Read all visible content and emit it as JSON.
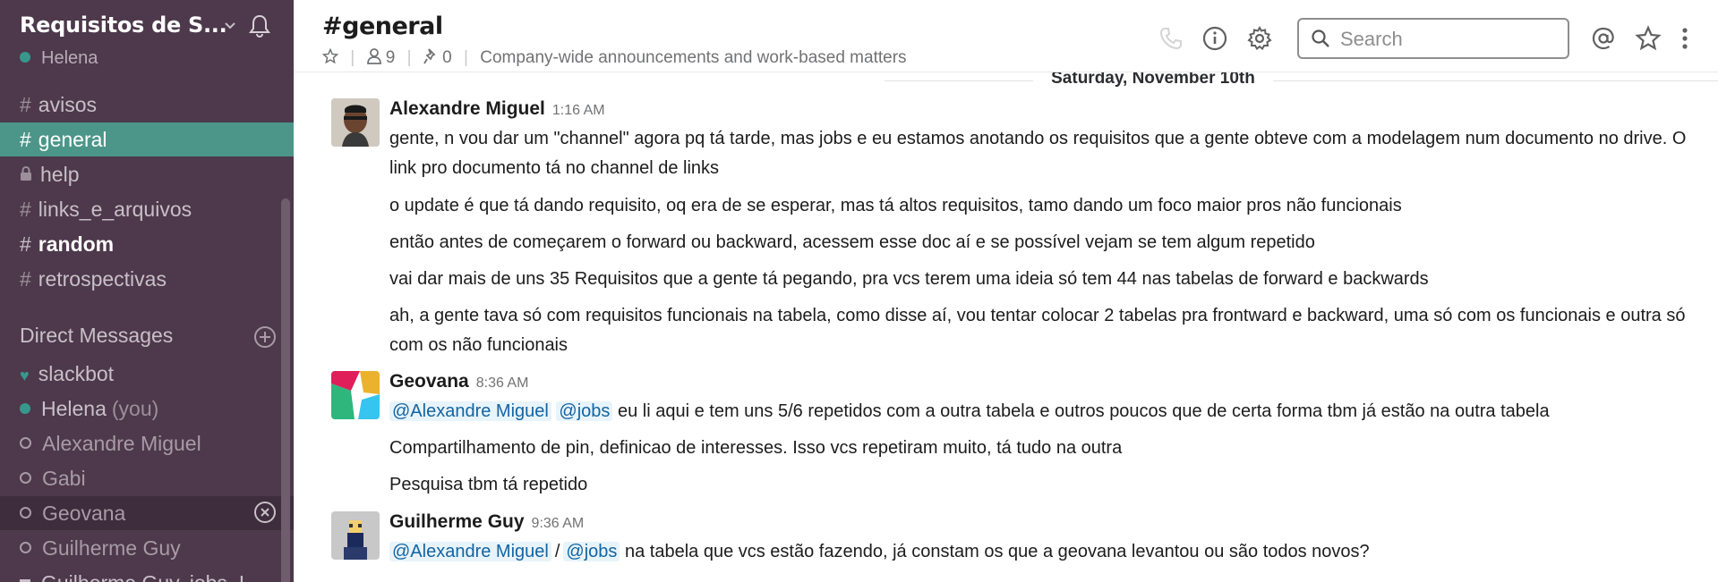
{
  "sidebar": {
    "team_name": "Requisitos de S...",
    "user": "Helena",
    "channels": [
      {
        "name": "avisos"
      },
      {
        "name": "general"
      },
      {
        "name": "help"
      },
      {
        "name": "links_e_arquivos"
      },
      {
        "name": "random"
      },
      {
        "name": "retrospectivas"
      }
    ],
    "dm_header": "Direct Messages",
    "dms": [
      {
        "name": "slackbot"
      },
      {
        "name": "Helena",
        "suffix": "(you)"
      },
      {
        "name": "Alexandre Miguel"
      },
      {
        "name": "Gabi"
      },
      {
        "name": "Geovana"
      },
      {
        "name": "Guilherme Guy"
      },
      {
        "name": "Guilherme Guy, jobs, I"
      }
    ]
  },
  "header": {
    "channel_title": "#general",
    "member_count": "9",
    "pinned_count": "0",
    "topic": "Company-wide announcements and work-based matters",
    "search_placeholder": "Search"
  },
  "messages": {
    "date_divider": "Saturday, November 10th",
    "groups": [
      {
        "author": "Alexandre Miguel",
        "time": "1:16 AM",
        "lines": [
          "gente, n vou dar um \"channel\" agora pq tá tarde, mas jobs e eu estamos anotando os requisitos que a gente obteve com a modelagem num documento no drive. O link pro documento tá no channel de links",
          "o update é que tá dando requisito, oq era de se esperar, mas tá altos requisitos, tamo dando um foco maior pros não funcionais",
          "então antes de começarem o forward ou backward, acessem esse doc aí e se possível vejam se tem algum repetido",
          "vai dar mais de uns 35 Requisitos que a gente tá pegando, pra vcs terem uma ideia só tem 44 nas tabelas de forward e backwards",
          "ah, a gente tava só com requisitos funcionais na tabela, como disse aí, vou tentar colocar 2 tabelas pra frontward e backward, uma só com os funcionais e outra só com os não funcionais"
        ]
      },
      {
        "author": "Geovana",
        "time": "8:36 AM",
        "mention1": "@Alexandre Miguel",
        "mention2": "@jobs",
        "line1_rest": "eu li aqui e tem uns 5/6 repetidos com a outra tabela e outros poucos que de certa forma tbm já estão na outra tabela",
        "lines": [
          "Compartilhamento de pin, definicao de interesses. Isso vcs repetiram muito, tá tudo na outra",
          "Pesquisa tbm tá repetido"
        ]
      },
      {
        "author": "Guilherme Guy",
        "time": "9:36 AM",
        "mention1": "@Alexandre Miguel",
        "separator": "/",
        "mention2": "@jobs",
        "line1_rest": "na tabela que vcs estão fazendo, já constam os que a geovana levantou ou são todos novos?"
      }
    ]
  }
}
